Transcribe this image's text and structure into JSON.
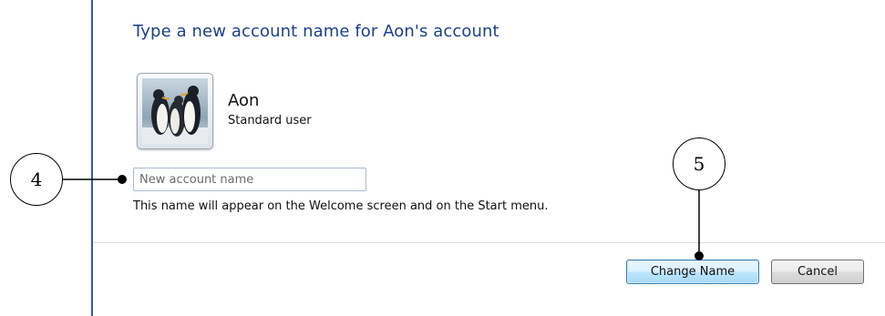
{
  "dialog": {
    "heading": "Type a new account name for Aon's account",
    "user": {
      "name": "Aon",
      "account_type": "Standard user",
      "avatar_icon": "penguins-picture"
    },
    "name_input": {
      "placeholder": "New account name",
      "value": ""
    },
    "hint": "This name will appear on the Welcome screen and on the Start menu.",
    "buttons": {
      "change_name": "Change Name",
      "cancel": "Cancel"
    }
  },
  "callouts": {
    "input_marker": "4",
    "button_marker": "5"
  },
  "colors": {
    "heading": "#1e3f8f",
    "frame_border": "#2f5fa8",
    "primary_button_border": "#3c7fb1"
  }
}
